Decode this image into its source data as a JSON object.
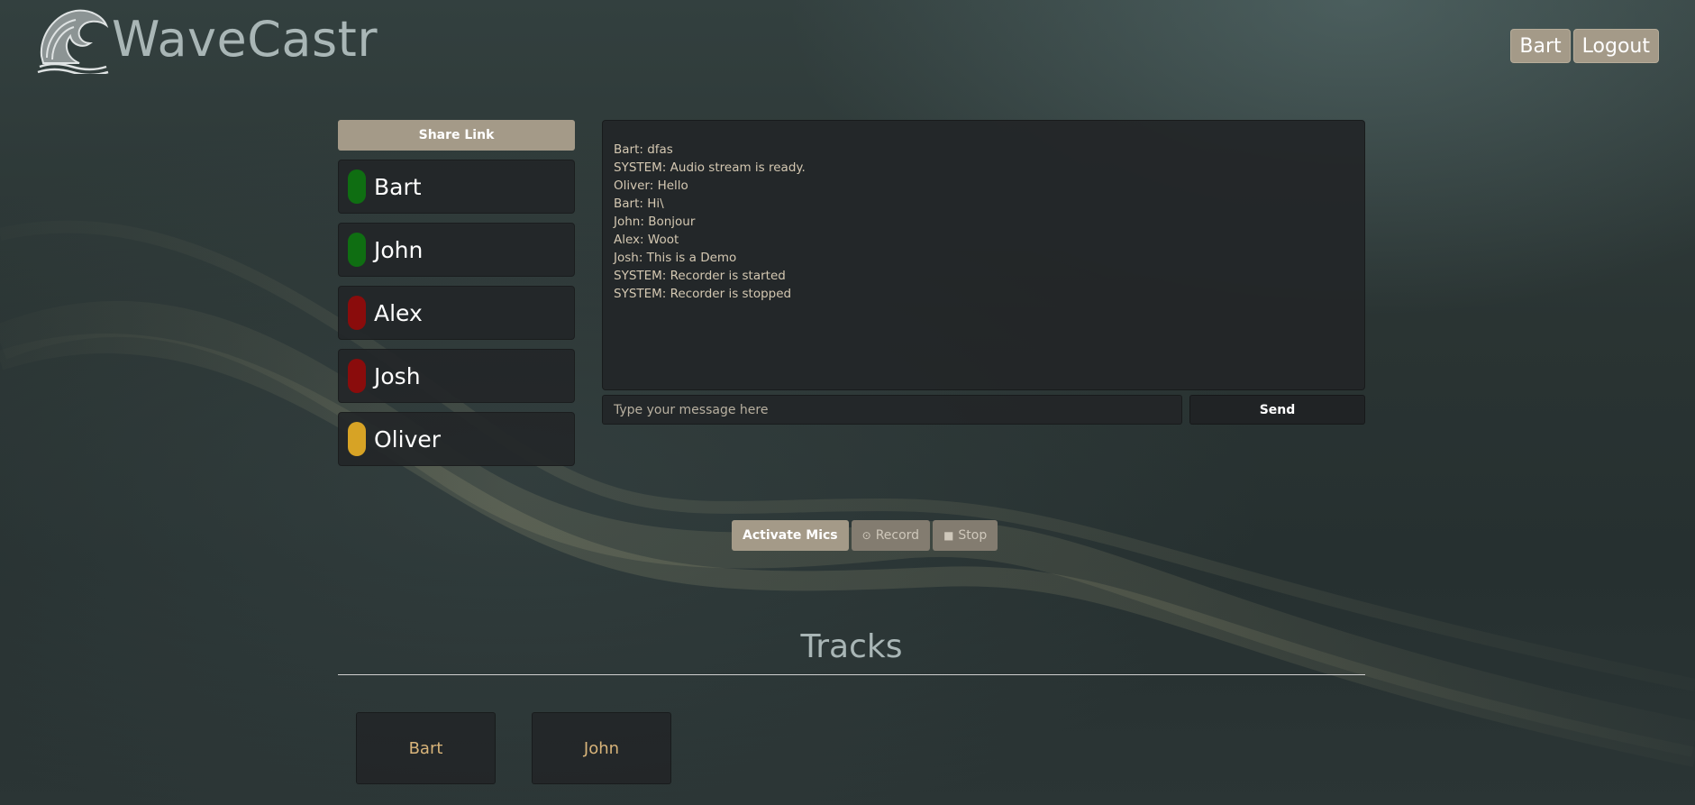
{
  "app": {
    "name": "WaveCastr"
  },
  "header": {
    "user_label": "Bart",
    "logout_label": "Logout"
  },
  "share": {
    "label": "Share Link"
  },
  "users": [
    {
      "name": "Bart",
      "status_color": "#0f6e12"
    },
    {
      "name": "John",
      "status_color": "#0f6e12"
    },
    {
      "name": "Alex",
      "status_color": "#8a0c0c"
    },
    {
      "name": "Josh",
      "status_color": "#8a0c0c"
    },
    {
      "name": "Oliver",
      "status_color": "#d7a325"
    }
  ],
  "chat": {
    "messages": [
      "Bart: dfas",
      "SYSTEM: Audio stream is ready.",
      "Oliver: Hello",
      "Bart: Hi\\",
      "John: Bonjour",
      "Alex: Woot",
      "Josh: This is a Demo",
      "SYSTEM: Recorder is started",
      "SYSTEM: Recorder is stopped"
    ],
    "input_placeholder": "Type your message here",
    "input_value": "",
    "send_label": "Send"
  },
  "controls": {
    "activate_label": "Activate Mics",
    "record_label": "Record",
    "record_icon": "record-circle-icon",
    "stop_label": "Stop",
    "stop_icon": "stop-square-icon"
  },
  "tracks": {
    "title": "Tracks",
    "items": [
      "Bart",
      "John"
    ]
  },
  "colors": {
    "accent": "#a49a88",
    "panel": "#232628",
    "brand_text": "#a9b6b6",
    "chat_text": "#d4c8b2",
    "track_text": "#d8b47a"
  }
}
